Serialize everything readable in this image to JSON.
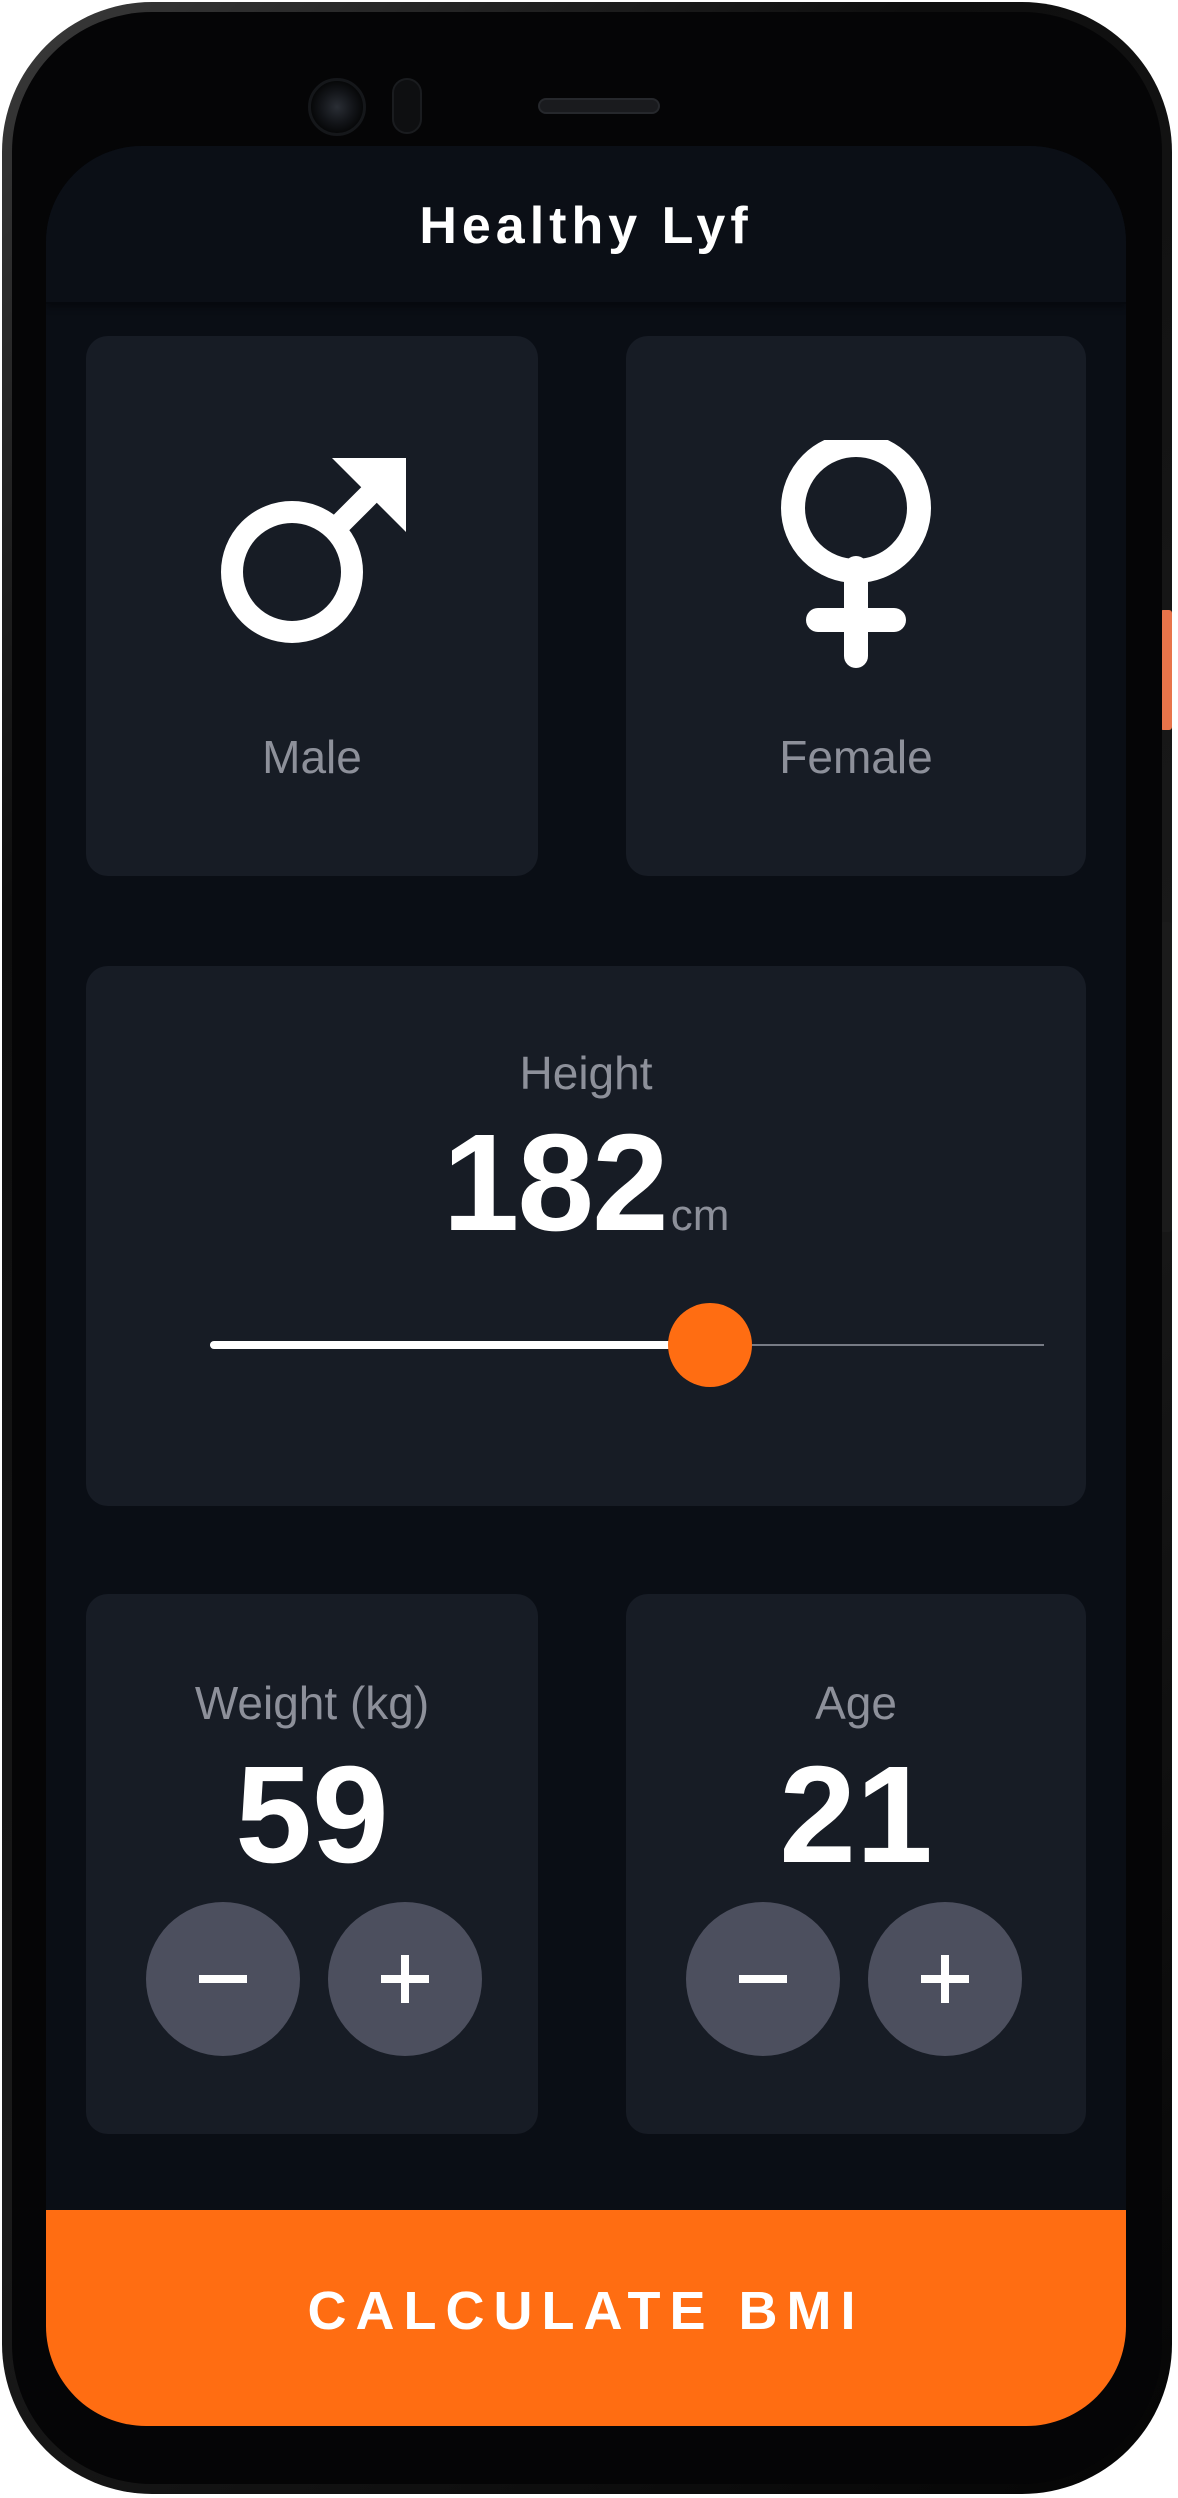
{
  "app": {
    "title": "Healthy Lyf"
  },
  "gender": {
    "male_label": "Male",
    "female_label": "Female",
    "male_icon": "male-symbol-icon",
    "female_icon": "female-symbol-icon"
  },
  "height": {
    "label": "Height",
    "value": "182",
    "unit": "cm",
    "slider_fraction": 0.6
  },
  "weight": {
    "label": "Weight (kg)",
    "value": "59"
  },
  "age": {
    "label": "Age",
    "value": "21"
  },
  "calculate": {
    "label": "CALCULATE BMI"
  },
  "icons": {
    "decrement": "minus-icon",
    "increment": "plus-icon"
  },
  "colors": {
    "accent": "#ff6d12",
    "background": "#0a0e15",
    "card": "#171c25",
    "button_round": "#4c4f5e",
    "label_text": "#8d909a",
    "side_button": "#e8744a"
  }
}
